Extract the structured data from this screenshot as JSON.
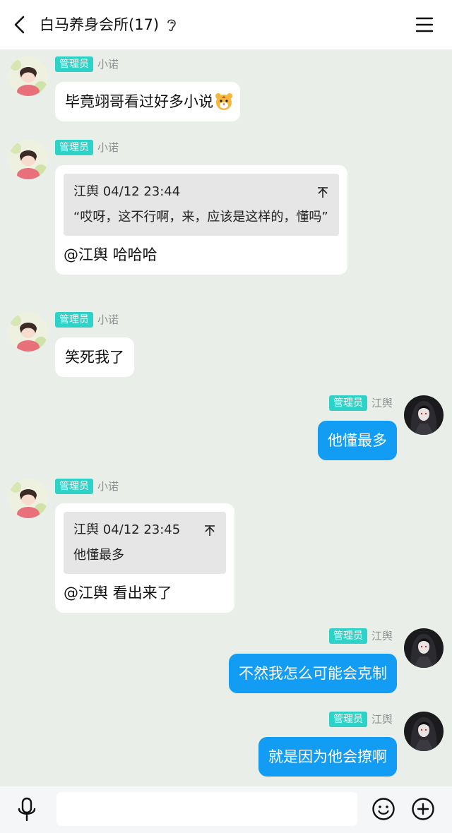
{
  "header": {
    "title": "白马养身会所(17)"
  },
  "admin_badge": "管理员",
  "messages": [
    {
      "nick": "小诺",
      "text": "毕竟翊哥看过好多小说"
    },
    {
      "nick": "小诺",
      "quote_header": "江舆 04/12 23:44",
      "quote_text": "“哎呀，这不行啊，来，应该是这样的，懂吗”",
      "text": "@江舆 哈哈哈"
    },
    {
      "nick": "小诺",
      "text": "笑死我了"
    },
    {
      "nick": "江舆",
      "text": "他懂最多"
    },
    {
      "nick": "小诺",
      "quote_header": "江舆 04/12 23:45",
      "quote_text": "他懂最多",
      "text": "@江舆 看出来了"
    },
    {
      "nick": "江舆",
      "text": "不然我怎么可能会克制"
    },
    {
      "nick": "江舆",
      "text": "就是因为他会撩啊"
    }
  ],
  "input": {
    "placeholder": ""
  },
  "colors": {
    "self_bubble": "#139cf3",
    "badge": "#2fd2c7",
    "background": "#e9eee9"
  },
  "icons": [
    "back-icon",
    "ear-icon",
    "menu-icon",
    "tiger-emoji-icon",
    "quote-jump-icon",
    "mic-icon",
    "smile-icon",
    "plus-icon"
  ]
}
